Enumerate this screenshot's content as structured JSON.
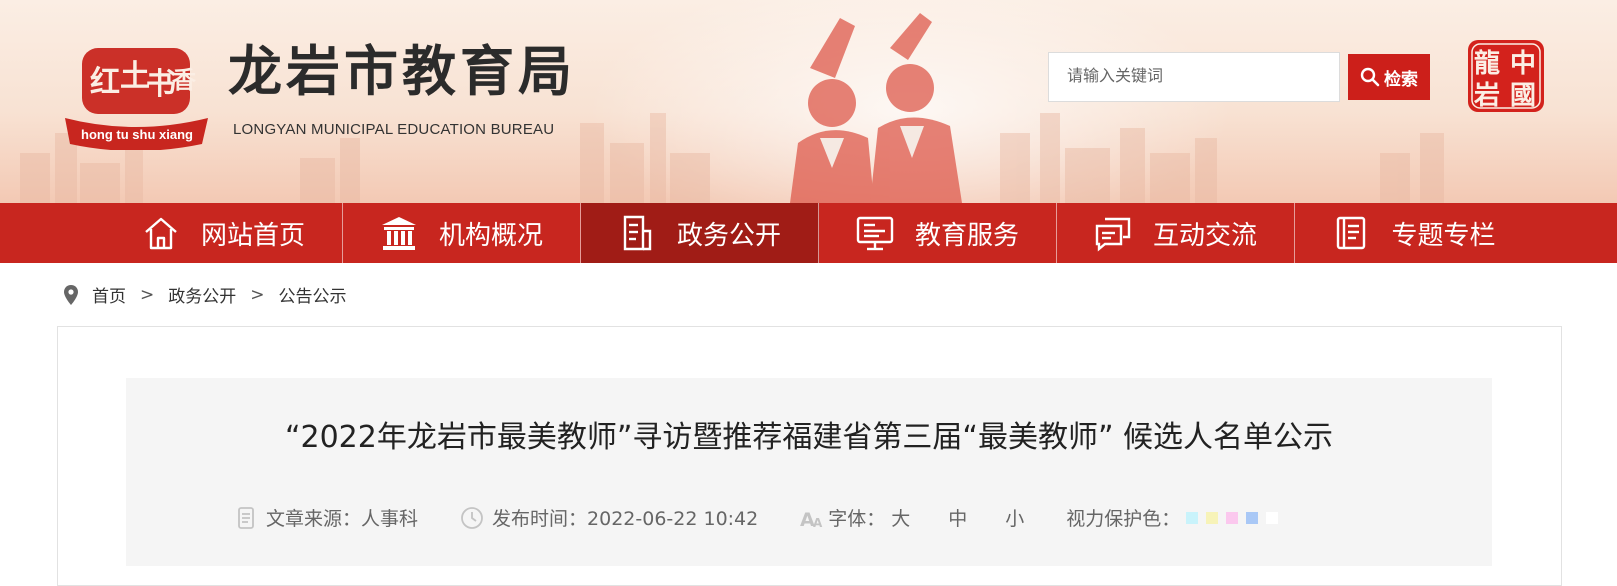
{
  "header": {
    "logo_lines": [
      "红",
      "土",
      "书",
      "香"
    ],
    "logo_caption": "hong tu shu xiang",
    "title": "龙岩市教育局",
    "subtitle": "LONGYAN MUNICIPAL EDUCATION BUREAU",
    "search_placeholder": "请输入关键词",
    "search_button": "检索",
    "seal_chars": [
      "龍",
      "中",
      "岩",
      "國"
    ]
  },
  "nav": {
    "items": [
      {
        "label": "网站首页",
        "icon": "home-icon"
      },
      {
        "label": "机构概况",
        "icon": "institution-icon"
      },
      {
        "label": "政务公开",
        "icon": "document-icon",
        "active": true
      },
      {
        "label": "教育服务",
        "icon": "monitor-icon"
      },
      {
        "label": "互动交流",
        "icon": "chat-icon"
      },
      {
        "label": "专题专栏",
        "icon": "book-icon"
      }
    ]
  },
  "breadcrumb": {
    "items": [
      "首页",
      "政务公开",
      "公告公示"
    ],
    "separator": ">"
  },
  "article": {
    "title": "“2022年龙岩市最美教师”寻访暨推荐福建省第三届“最美教师” 候选人名单公示",
    "source_label": "文章来源：人事科",
    "time_label": "发布时间：2022-06-22 10:42",
    "font_label": "字体：",
    "font_sizes": [
      "大",
      "中",
      "小"
    ],
    "eye_label": "视力保护色：",
    "eye_colors": [
      "#c9f3fb",
      "#f7f3b8",
      "#fbc8ee",
      "#a9c8f6",
      "#ffffff"
    ]
  },
  "colors": {
    "accent": "#c8261f",
    "nav_active": "#a01c16",
    "search_button": "#cc1f1a"
  }
}
